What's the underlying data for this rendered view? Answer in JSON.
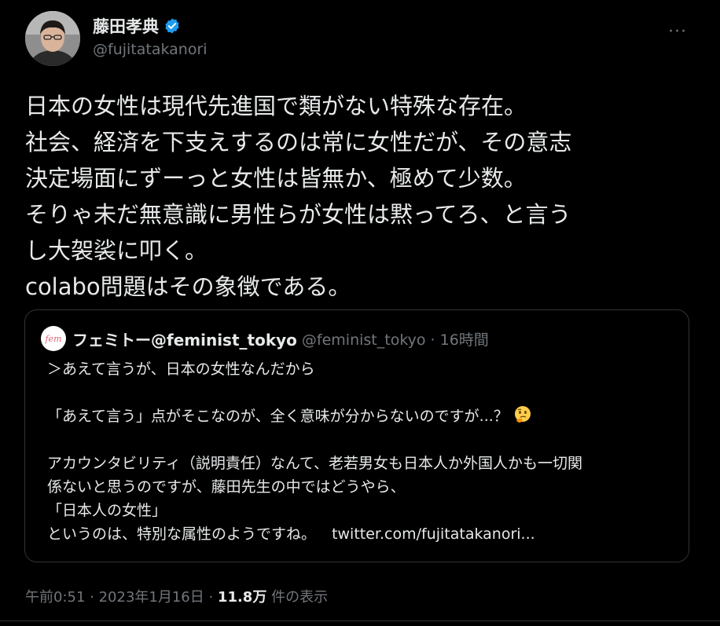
{
  "author": {
    "display_name": "藤田孝典",
    "handle": "@fujitatakanori",
    "verified_color": "#1d9bf0"
  },
  "more_menu_label": "···",
  "tweet_lines": [
    "日本の女性は現代先進国で類がない特殊な存在。",
    "社会、経済を下支えするのは常に女性だが、その意志",
    "決定場面にずーっと女性は皆無か、極めて少数。",
    "そりゃ未だ無意識に男性らが女性は黙ってろ、と言う",
    "し大袈裟に叩く。",
    "colabo問題はその象徴である。"
  ],
  "quoted_tweet": {
    "avatar_label": "fem",
    "display_name": "フェミトー@feminist_tokyo",
    "handle_time": "@feminist_tokyo · 16時間",
    "line1": "＞あえて言うが、日本の女性なんだから",
    "line2": "「あえて言う」点がそこなのが、全く意味が分からないのですが...？",
    "line3": "アカウンタビリティ（説明責任）なんて、老若男女も日本人か外国人かも一切関",
    "line4": "係ないと思うのですが、藤田先生の中ではどうやら、",
    "line5": "「日本人の女性」",
    "line6_text": "というのは、特別な属性のようですね。",
    "line6_link": "twitter.com/fujitatakanori...",
    "emoji": "thinking-face"
  },
  "meta": {
    "timestamp": "午前0:51 · 2023年1月16日 · ",
    "views_count": "11.8万",
    "views_label": " 件の表示"
  }
}
